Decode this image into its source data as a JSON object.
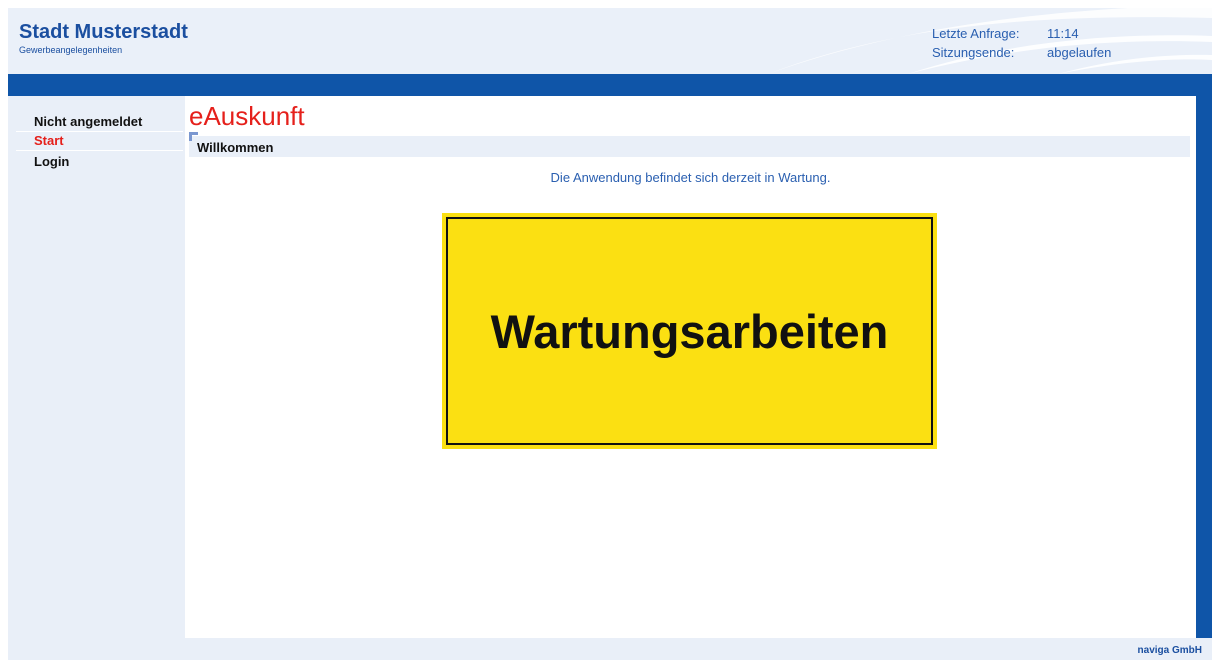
{
  "header": {
    "title": "Stadt Musterstadt",
    "subtitle": "Gewerbeangelegenheiten",
    "session": {
      "last_request_label": "Letzte Anfrage:",
      "last_request_value": "11:14",
      "session_end_label": "Sitzungsende:",
      "session_end_value": "abgelaufen"
    }
  },
  "sidebar": {
    "status": "Nicht angemeldet",
    "items": [
      {
        "label": "Start",
        "active": true
      },
      {
        "label": "Login",
        "active": false
      }
    ]
  },
  "main": {
    "app_title": "eAuskunft",
    "section_title": "Willkommen",
    "notice": "Die Anwendung befindet sich derzeit in Wartung.",
    "sign_text": "Wartungsarbeiten"
  },
  "footer": {
    "vendor": "naviga GmbH"
  },
  "colors": {
    "brand_blue": "#0f55a8",
    "accent_red": "#e5201b",
    "sign_yellow": "#fbe012",
    "light_blue": "#e9eff8"
  }
}
